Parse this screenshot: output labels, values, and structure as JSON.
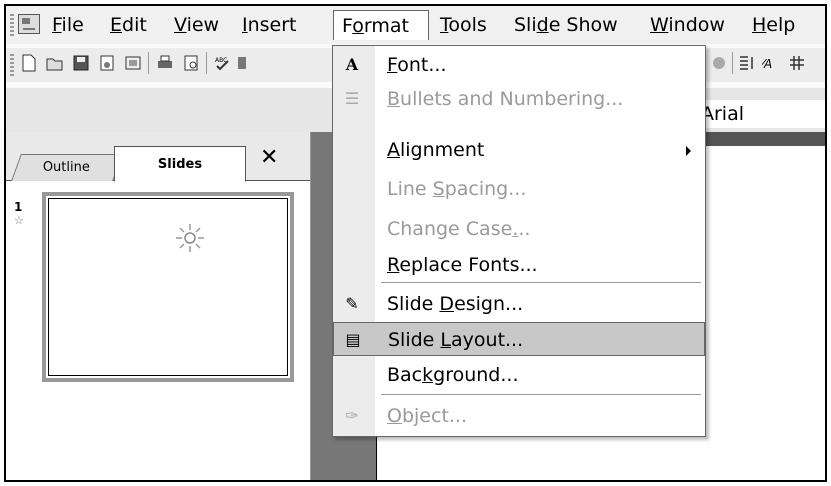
{
  "menubar": {
    "items": [
      {
        "label": "File",
        "mnemonic_index": 0
      },
      {
        "label": "Edit",
        "mnemonic_index": 0
      },
      {
        "label": "View",
        "mnemonic_index": 0
      },
      {
        "label": "Insert",
        "mnemonic_index": 0
      },
      {
        "label": "Format",
        "mnemonic_index": 1
      },
      {
        "label": "Tools",
        "mnemonic_index": 0
      },
      {
        "label": "Slide Show",
        "mnemonic_index": 3
      },
      {
        "label": "Window",
        "mnemonic_index": 0
      },
      {
        "label": "Help",
        "mnemonic_index": 0
      }
    ]
  },
  "toolbar": {
    "font_name": "Arial",
    "icons": [
      "new-icon",
      "open-icon",
      "save-icon",
      "permission-icon",
      "email-icon",
      "print-icon",
      "print-preview-icon",
      "spelling-icon",
      "research-icon"
    ]
  },
  "format_menu": {
    "items": [
      {
        "label": "Font...",
        "icon": "font-icon",
        "glyph": "A",
        "enabled": true,
        "highlighted": false
      },
      {
        "label": "Bullets and Numbering...",
        "icon": "bullets-icon",
        "glyph": "☰",
        "enabled": false,
        "highlighted": false
      },
      {
        "label": "Alignment",
        "icon": "",
        "glyph": "",
        "enabled": true,
        "submenu": true,
        "highlighted": false
      },
      {
        "label": "Line Spacing...",
        "icon": "",
        "glyph": "",
        "enabled": false,
        "highlighted": false
      },
      {
        "label": "Change Case...",
        "icon": "",
        "glyph": "",
        "enabled": false,
        "highlighted": false
      },
      {
        "label": "Replace Fonts...",
        "icon": "",
        "glyph": "",
        "enabled": true,
        "highlighted": false
      },
      {
        "label": "Slide Design...",
        "icon": "slide-design-icon",
        "glyph": "✎",
        "enabled": true,
        "highlighted": false
      },
      {
        "label": "Slide Layout...",
        "icon": "slide-layout-icon",
        "glyph": "▤",
        "enabled": true,
        "highlighted": true
      },
      {
        "label": "Background...",
        "icon": "",
        "glyph": "",
        "enabled": true,
        "highlighted": false
      },
      {
        "label": "Object...",
        "icon": "object-icon",
        "glyph": "✑",
        "enabled": false,
        "highlighted": false
      }
    ]
  },
  "left_pane": {
    "tabs": [
      {
        "label": "Outline",
        "active": false
      },
      {
        "label": "Slides",
        "active": true
      }
    ],
    "close_label": "✕",
    "slide_number": "1",
    "transition_marker": "☆"
  }
}
